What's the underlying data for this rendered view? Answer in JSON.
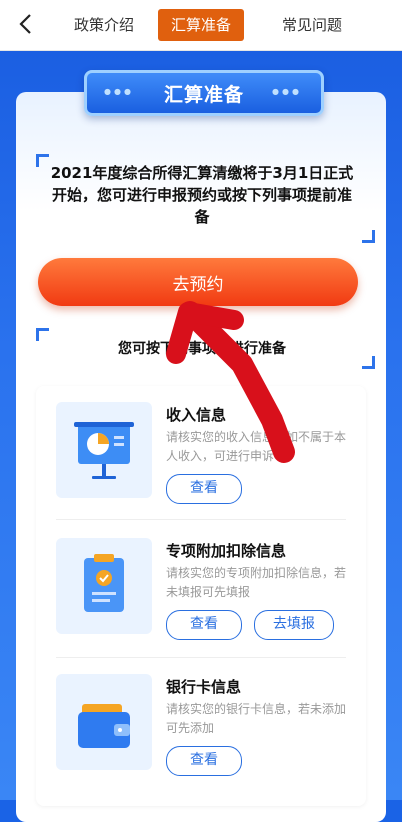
{
  "tabs": [
    {
      "label": "政策介绍"
    },
    {
      "label": "汇算准备"
    },
    {
      "label": "常见问题"
    }
  ],
  "active_tab": 1,
  "section_title": "汇算准备",
  "intro_text": "2021年度综合所得汇算清缴将于3月1日正式开始，您可进行申报预约或按下列事项提前准备",
  "reserve_button": "去预约",
  "sub_heading": "您可按下列事项先进行准备",
  "items": [
    {
      "title": "收入信息",
      "desc": "请核实您的收入信息，如不属于本人收入，可进行申诉",
      "buttons": [
        "查看"
      ]
    },
    {
      "title": "专项附加扣除信息",
      "desc": "请核实您的专项附加扣除信息，若未填报可先填报",
      "buttons": [
        "查看",
        "去填报"
      ]
    },
    {
      "title": "银行卡信息",
      "desc": "请核实您的银行卡信息，若未添加可先添加",
      "buttons": [
        "查看"
      ]
    }
  ],
  "colors": {
    "accent_orange": "#f13a12",
    "brand_blue": "#1a63e6",
    "annotation_red": "#d8101b"
  }
}
